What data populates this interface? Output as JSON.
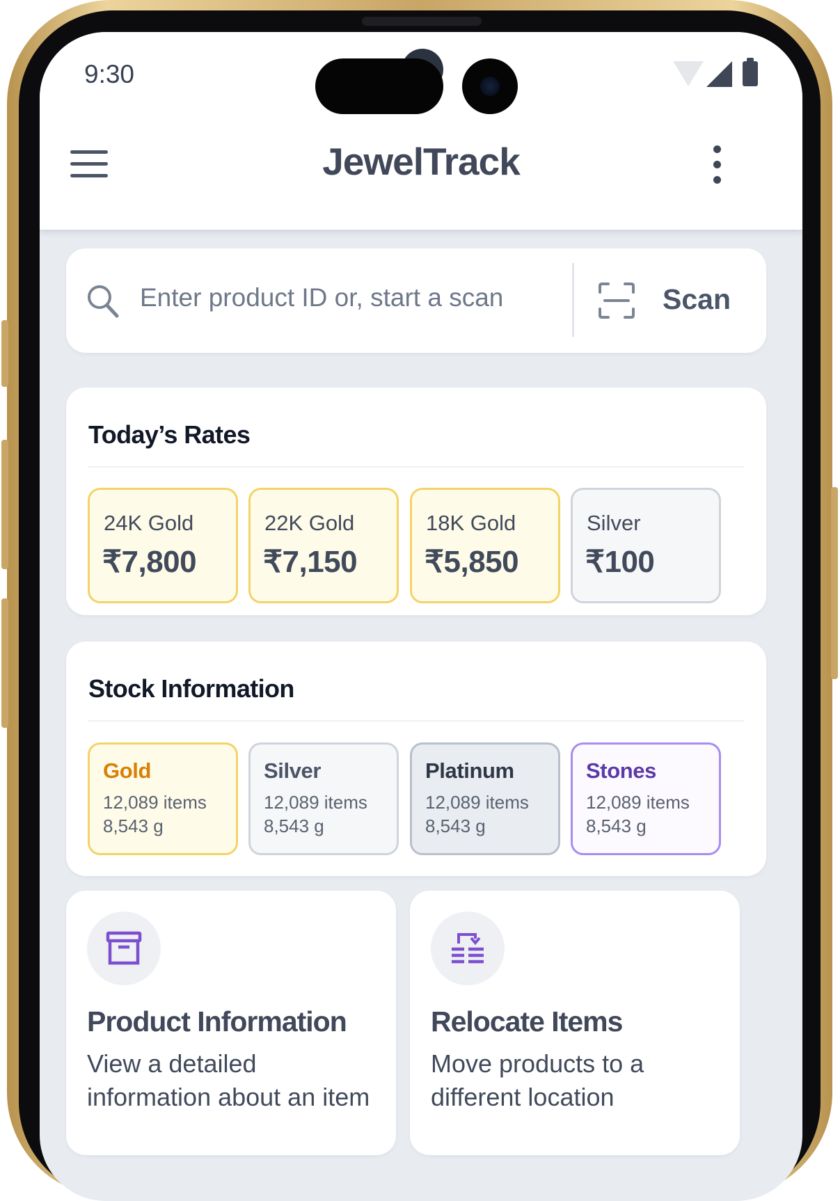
{
  "status_bar": {
    "time": "9:30"
  },
  "header": {
    "title": "JewelTrack",
    "menu_icon": "hamburger-menu-icon",
    "overflow_icon": "kebab-menu-icon"
  },
  "search": {
    "placeholder": "Enter product ID or, start a scan",
    "scan_label": "Scan",
    "search_icon": "search-icon",
    "scan_icon": "scan-frame-icon"
  },
  "rates": {
    "title": "Today’s Rates",
    "items": [
      {
        "name": "24K Gold",
        "value": "₹7,800"
      },
      {
        "name": "22K Gold",
        "value": "₹7,150"
      },
      {
        "name": "18K Gold",
        "value": "₹5,850"
      },
      {
        "name": "Silver",
        "value": "₹100"
      }
    ]
  },
  "stock": {
    "title": "Stock Information",
    "items": [
      {
        "name": "Gold",
        "items": "12,089 items",
        "weight": "8,543 g"
      },
      {
        "name": "Silver",
        "items": "12,089 items",
        "weight": "8,543 g"
      },
      {
        "name": "Platinum",
        "items": "12,089 items",
        "weight": "8,543 g"
      },
      {
        "name": "Stones",
        "items": "12,089 items",
        "weight": "8,543 g"
      }
    ]
  },
  "actions": [
    {
      "title": "Product Information",
      "description": "View a detailed information about an item",
      "icon": "archive-box-icon"
    },
    {
      "title": "Relocate Items",
      "description": "Move products to a different location",
      "icon": "relocate-stack-icon"
    }
  ],
  "colors": {
    "gold_accent": "#d98006",
    "stones_accent": "#5b3aa8",
    "action_icon": "#7c4fd0",
    "heading": "#404859"
  }
}
